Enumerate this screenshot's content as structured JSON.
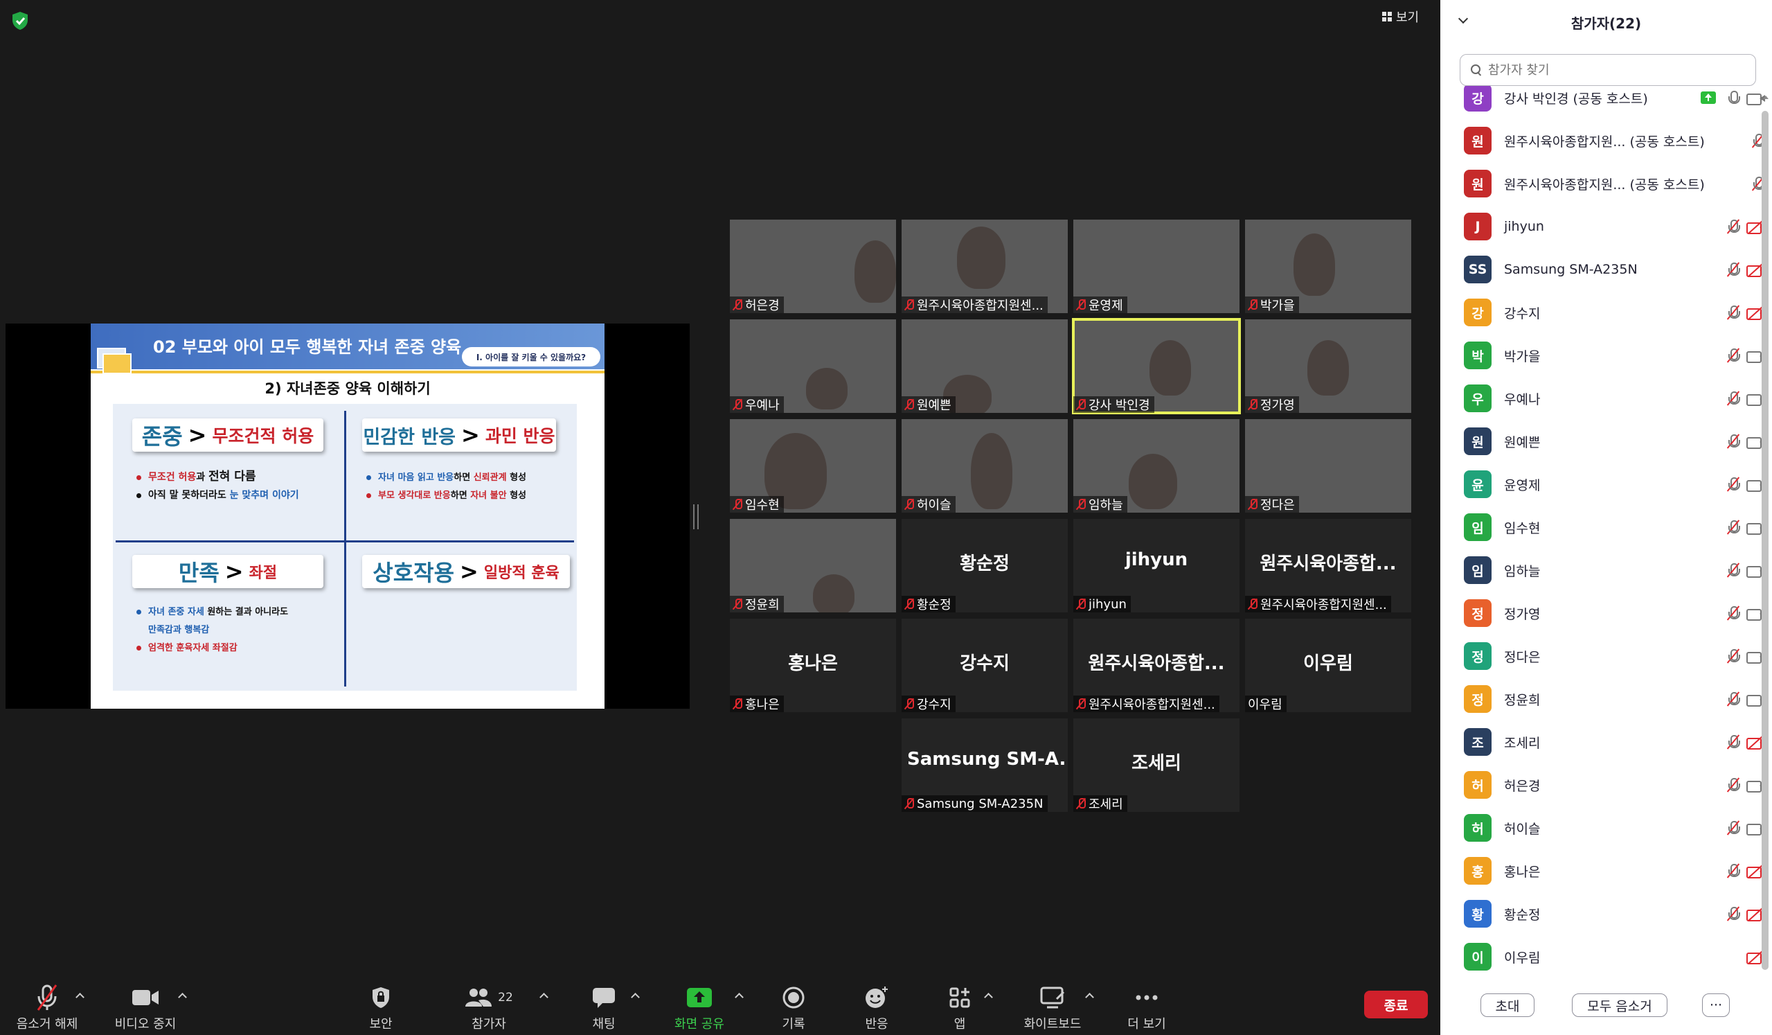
{
  "top_bar": {
    "view_label": "보기"
  },
  "slide": {
    "title": "02 부모와 아이 모두 행복한 자녀 존중 양육",
    "pill": "Ⅰ. 아이를 잘 키울 수 있을까요?",
    "subtitle": "2) 자녀존중 양육 이해하기",
    "quadrants": [
      {
        "left": "존중",
        "right": "무조건적 허용",
        "bullets": [
          {
            "parts": [
              "무조건 허용",
              "과 ",
              "전혀 다름"
            ]
          },
          {
            "parts": [
              "아직 말 못하더라도 ",
              "눈 맞추며 이야기"
            ]
          }
        ]
      },
      {
        "left": "민감한 반응",
        "right": "과민 반응",
        "bullets": [
          {
            "parts": [
              "자녀 마음 읽고 반응",
              "하면 ",
              "신뢰관계",
              " 형성"
            ]
          },
          {
            "parts": [
              "부모 생각대로 반응",
              "하면 ",
              "자녀 불안",
              " 형성"
            ]
          }
        ]
      },
      {
        "left": "만족",
        "right": "좌절",
        "bullets": [
          {
            "parts": [
              "자녀 존중 자세",
              " 원하는 결과 아니라도"
            ]
          },
          {
            "parts": [
              "만족감과 행복감"
            ]
          },
          {
            "parts": [
              "엄격한 훈육자세",
              " 좌절감"
            ]
          }
        ]
      },
      {
        "left": "상호작용",
        "right": "일방적 훈육",
        "bullets": []
      }
    ]
  },
  "gallery": {
    "tiles": [
      {
        "label": "허은경",
        "big": "",
        "video": true
      },
      {
        "label": "원주시육아종합지원센...",
        "big": "",
        "video": true
      },
      {
        "label": "윤영제",
        "big": "",
        "video": true
      },
      {
        "label": "박가을",
        "big": "",
        "video": true
      },
      {
        "label": "우예나",
        "big": "",
        "video": true
      },
      {
        "label": "원예쁜",
        "big": "",
        "video": true
      },
      {
        "label": "강사 박인경",
        "big": "",
        "video": true,
        "active": true
      },
      {
        "label": "정가영",
        "big": "",
        "video": true
      },
      {
        "label": "임수현",
        "big": "",
        "video": true
      },
      {
        "label": "허이슬",
        "big": "",
        "video": true
      },
      {
        "label": "임하늘",
        "big": "",
        "video": true
      },
      {
        "label": "정다은",
        "big": "",
        "video": true
      },
      {
        "label": "정윤희",
        "big": "",
        "video": true
      },
      {
        "label": "황순정",
        "big": "황순정",
        "video": false
      },
      {
        "label": "jihyun",
        "big": "jihyun",
        "video": false
      },
      {
        "label": "원주시육아종합지원센...",
        "big": "원주시육아종합...",
        "video": false
      },
      {
        "label": "홍나은",
        "big": "홍나은",
        "video": false
      },
      {
        "label": "강수지",
        "big": "강수지",
        "video": false
      },
      {
        "label": "원주시육아종합지원센...",
        "big": "원주시육아종합...",
        "video": false
      },
      {
        "label": "이우림",
        "big": "이우림",
        "video": false,
        "mic_on": true
      },
      {
        "label": "Samsung SM-A235N",
        "big": "Samsung  SM-A...",
        "video": false
      },
      {
        "label": "조세리",
        "big": "조세리",
        "video": false
      }
    ]
  },
  "toolbar": {
    "unmute": "음소거 해제",
    "video": "비디오 중지",
    "security": "보안",
    "participants": "참가자",
    "participants_count": "22",
    "chat": "채팅",
    "share": "화면 공유",
    "record": "기록",
    "reactions": "반응",
    "apps": "앱",
    "whiteboard": "화이트보드",
    "more": "더 보기",
    "end": "종료"
  },
  "participants_panel": {
    "title": "참가자(22)",
    "search_placeholder": "참가자 찾기",
    "participants": [
      {
        "initial": "강",
        "name": "강사 박인경 (공동 호스트)",
        "color": "#8f3fc4",
        "mic": "on",
        "cam": "on",
        "sharing": true
      },
      {
        "initial": "원",
        "name": "원주시육아종합지원...  (공동 호스트)",
        "color": "#c62b2b",
        "mic": "off",
        "cam": "none"
      },
      {
        "initial": "원",
        "name": "원주시육아종합지원...  (공동 호스트)",
        "color": "#c62b2b",
        "mic": "off",
        "cam": "none"
      },
      {
        "initial": "J",
        "name": "jihyun",
        "color": "#c62b2b",
        "mic": "off",
        "cam": "off"
      },
      {
        "initial": "SS",
        "name": "Samsung SM-A235N",
        "color": "#2a3f5f",
        "mic": "off",
        "cam": "off"
      },
      {
        "initial": "강",
        "name": "강수지",
        "color": "#f0a020",
        "mic": "off",
        "cam": "off"
      },
      {
        "initial": "박",
        "name": "박가을",
        "color": "#27a844",
        "mic": "off",
        "cam": "on"
      },
      {
        "initial": "우",
        "name": "우예나",
        "color": "#27a844",
        "mic": "off",
        "cam": "on"
      },
      {
        "initial": "원",
        "name": "원예쁜",
        "color": "#2a3f5f",
        "mic": "off",
        "cam": "on"
      },
      {
        "initial": "윤",
        "name": "윤영제",
        "color": "#20a37a",
        "mic": "off",
        "cam": "on"
      },
      {
        "initial": "임",
        "name": "임수현",
        "color": "#27a844",
        "mic": "off",
        "cam": "on"
      },
      {
        "initial": "임",
        "name": "임하늘",
        "color": "#2a3f5f",
        "mic": "off",
        "cam": "on"
      },
      {
        "initial": "정",
        "name": "정가영",
        "color": "#e8602c",
        "mic": "off",
        "cam": "on"
      },
      {
        "initial": "정",
        "name": "정다은",
        "color": "#20a37a",
        "mic": "off",
        "cam": "on"
      },
      {
        "initial": "정",
        "name": "정윤희",
        "color": "#f0a020",
        "mic": "off",
        "cam": "on"
      },
      {
        "initial": "조",
        "name": "조세리",
        "color": "#2a3f5f",
        "mic": "off",
        "cam": "off"
      },
      {
        "initial": "허",
        "name": "허은경",
        "color": "#f0a020",
        "mic": "off",
        "cam": "on"
      },
      {
        "initial": "허",
        "name": "허이슬",
        "color": "#27a844",
        "mic": "off",
        "cam": "on"
      },
      {
        "initial": "홍",
        "name": "홍나은",
        "color": "#f0a020",
        "mic": "off",
        "cam": "off"
      },
      {
        "initial": "황",
        "name": "황순정",
        "color": "#2f6fd0",
        "mic": "off",
        "cam": "off"
      },
      {
        "initial": "이",
        "name": "이우림",
        "color": "#27a844",
        "mic": "none",
        "cam": "off"
      }
    ],
    "invite_label": "초대",
    "mute_all_label": "모두 음소거",
    "more_label": "···"
  },
  "colors": {
    "end_red": "#d0202b",
    "share_green": "#3ccf4e",
    "active_speaker": "#e7f05a",
    "slide_accent_blue": "#1f6f99",
    "slide_accent_red": "#c9242c"
  }
}
